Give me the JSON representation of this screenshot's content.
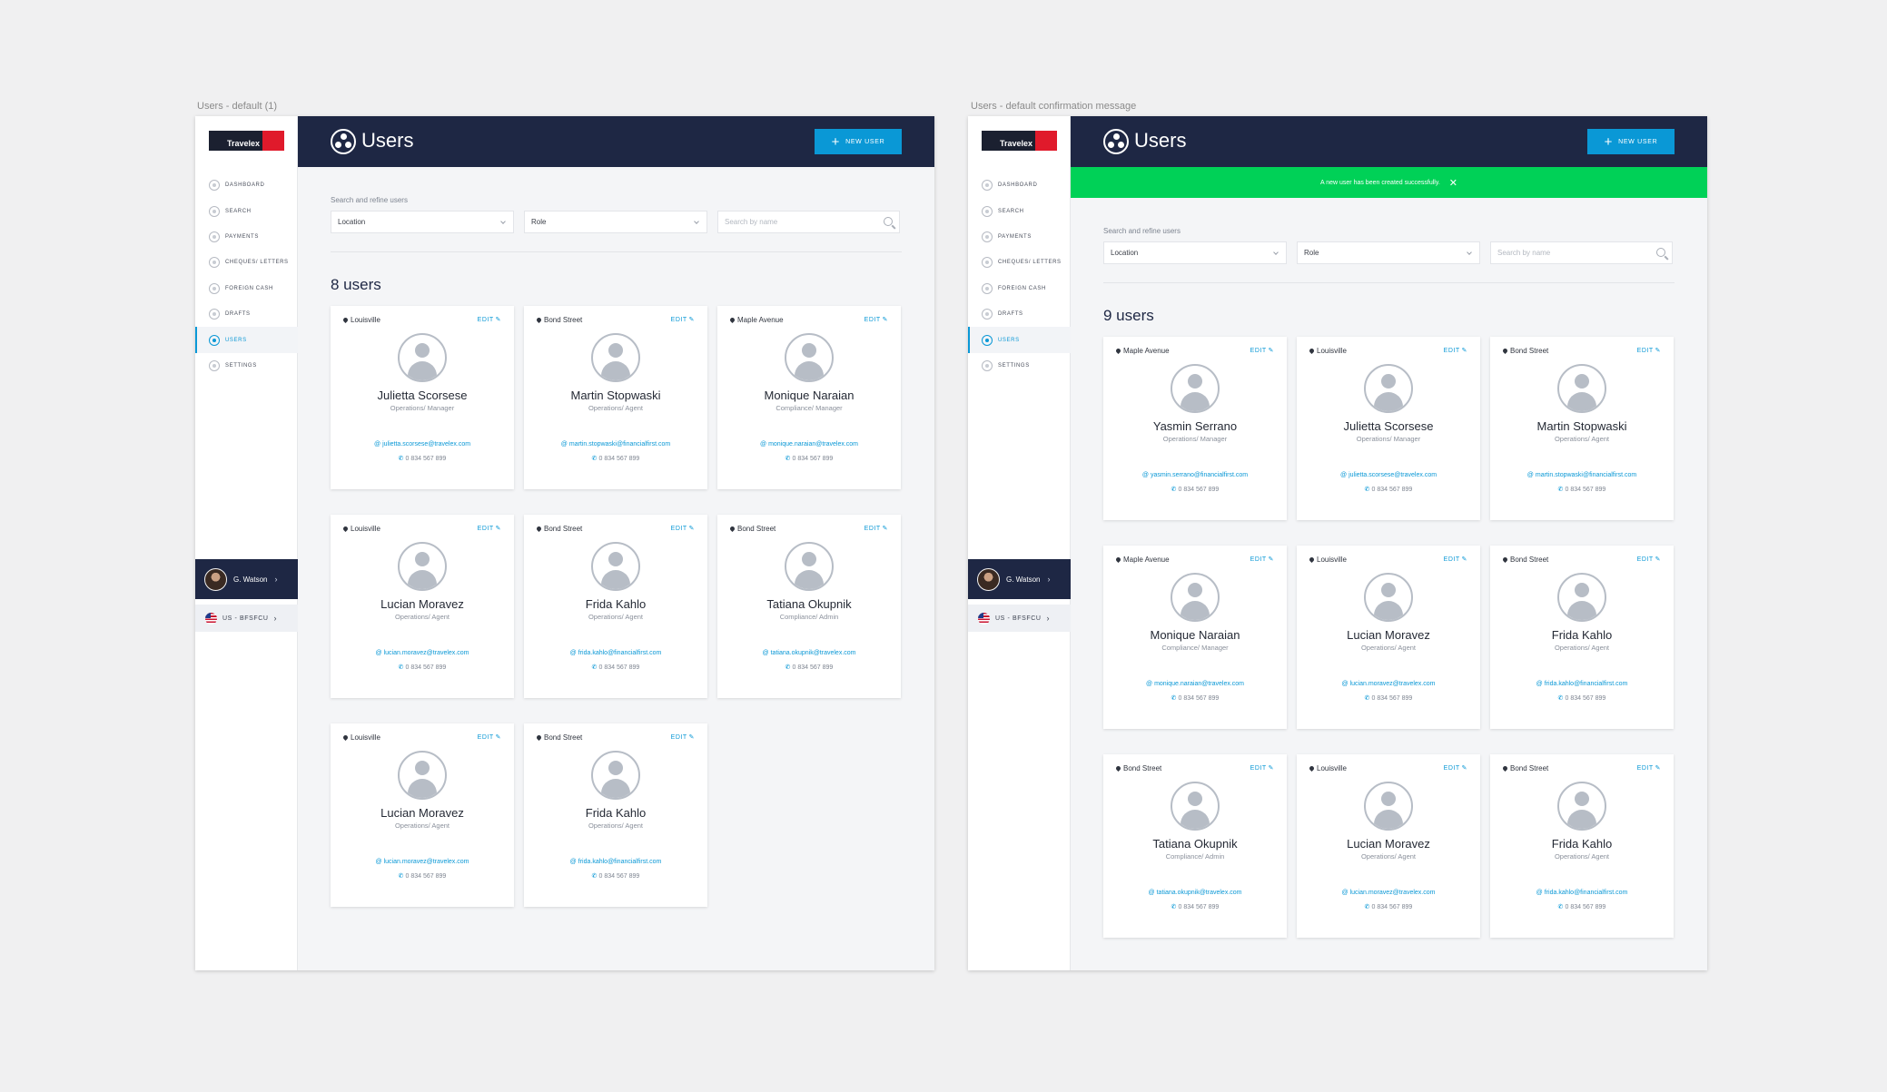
{
  "artboards": [
    {
      "label": "Users - default (1)",
      "logo_text": "Travelex",
      "nav": [
        "DASHBOARD",
        "SEARCH",
        "PAYMENTS",
        "CHEQUES/ LETTERS",
        "FOREIGN CASH",
        "DRAFTS",
        "USERS",
        "SETTINGS"
      ],
      "user_name": "G. Watson",
      "region": "US - BFSFCU",
      "title": "Users",
      "new_user": "NEW USER",
      "toast": "",
      "filter_title": "Search and refine users",
      "location": "Location",
      "role": "Role",
      "search_placeholder": "Search by name",
      "count": "8 users",
      "users": [
        {
          "location": "Louisville",
          "name": "Julietta Scorsese",
          "role": "Operations/ Manager",
          "email": "julietta.scorsese@travelex.com",
          "phone": "0 834 567 899"
        },
        {
          "location": "Bond Street",
          "name": "Martin Stopwaski",
          "role": "Operations/ Agent",
          "email": "martin.stopwaski@financialfirst.com",
          "phone": "0 834 567 899"
        },
        {
          "location": "Maple Avenue",
          "name": "Monique Naraian",
          "role": "Compliance/ Manager",
          "email": "monique.naraian@travelex.com",
          "phone": "0 834 567 899"
        },
        {
          "location": "Louisville",
          "name": "Lucian Moravez",
          "role": "Operations/ Agent",
          "email": "lucian.moravez@travelex.com",
          "phone": "0 834 567 899"
        },
        {
          "location": "Bond Street",
          "name": "Frida Kahlo",
          "role": "Operations/ Agent",
          "email": "frida.kahlo@financialfirst.com",
          "phone": "0 834 567 899"
        },
        {
          "location": "Bond Street",
          "name": "Tatiana Okupnik",
          "role": "Compliance/ Admin",
          "email": "tatiana.okupnik@travelex.com",
          "phone": "0 834 567 899"
        },
        {
          "location": "Louisville",
          "name": "Lucian Moravez",
          "role": "Operations/ Agent",
          "email": "lucian.moravez@travelex.com",
          "phone": "0 834 567 899"
        },
        {
          "location": "Bond Street",
          "name": "Frida Kahlo",
          "role": "Operations/ Agent",
          "email": "frida.kahlo@financialfirst.com",
          "phone": "0 834 567 899"
        }
      ]
    },
    {
      "label": "Users - default confirmation message",
      "logo_text": "Travelex",
      "nav": [
        "DASHBOARD",
        "SEARCH",
        "PAYMENTS",
        "CHEQUES/ LETTERS",
        "FOREIGN CASH",
        "DRAFTS",
        "USERS",
        "SETTINGS"
      ],
      "user_name": "G. Watson",
      "region": "US - BFSFCU",
      "title": "Users",
      "new_user": "NEW USER",
      "toast": "A new user has been created successfully.",
      "filter_title": "Search and refine users",
      "location": "Location",
      "role": "Role",
      "search_placeholder": "Search by name",
      "count": "9 users",
      "users": [
        {
          "location": "Maple Avenue",
          "name": "Yasmin Serrano",
          "role": "Operations/ Manager",
          "email": "yasmin.serrano@financialfirst.com",
          "phone": "0 834 567 899"
        },
        {
          "location": "Louisville",
          "name": "Julietta Scorsese",
          "role": "Operations/ Manager",
          "email": "julietta.scorsese@travelex.com",
          "phone": "0 834 567 899"
        },
        {
          "location": "Bond Street",
          "name": "Martin Stopwaski",
          "role": "Operations/ Agent",
          "email": "martin.stopwaski@financialfirst.com",
          "phone": "0 834 567 899"
        },
        {
          "location": "Maple Avenue",
          "name": "Monique Naraian",
          "role": "Compliance/ Manager",
          "email": "monique.naraian@travelex.com",
          "phone": "0 834 567 899"
        },
        {
          "location": "Louisville",
          "name": "Lucian Moravez",
          "role": "Operations/ Agent",
          "email": "lucian.moravez@travelex.com",
          "phone": "0 834 567 899"
        },
        {
          "location": "Bond Street",
          "name": "Frida Kahlo",
          "role": "Operations/ Agent",
          "email": "frida.kahlo@financialfirst.com",
          "phone": "0 834 567 899"
        },
        {
          "location": "Bond Street",
          "name": "Tatiana Okupnik",
          "role": "Compliance/ Admin",
          "email": "tatiana.okupnik@travelex.com",
          "phone": "0 834 567 899"
        },
        {
          "location": "Louisville",
          "name": "Lucian Moravez",
          "role": "Operations/ Agent",
          "email": "lucian.moravez@travelex.com",
          "phone": "0 834 567 899"
        },
        {
          "location": "Bond Street",
          "name": "Frida Kahlo",
          "role": "Operations/ Agent",
          "email": "frida.kahlo@financialfirst.com",
          "phone": "0 834 567 899"
        }
      ]
    }
  ],
  "icons": {
    "nav": [
      "dashboard-icon",
      "search-icon",
      "payments-icon",
      "cheques-icon",
      "foreign-cash-icon",
      "drafts-icon",
      "users-icon",
      "settings-icon"
    ],
    "card_location": "map-pin-icon",
    "card_edit": "pencil-icon",
    "email": "at-icon",
    "phone": "phone-icon",
    "search": "magnifier-icon",
    "close": "close-icon"
  },
  "colors": {
    "header": "#1e2744",
    "accent": "#0a98d6",
    "success": "#00d157",
    "brand_red": "#e01a2b"
  },
  "edit_label": "EDIT",
  "active_nav": "USERS"
}
